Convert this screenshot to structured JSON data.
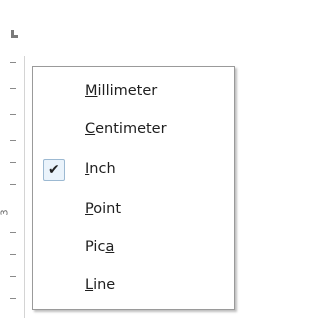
{
  "ruler": {
    "number": "3"
  },
  "menu": {
    "items": [
      {
        "mnemonic": "M",
        "rest": "illimeter",
        "checked": false
      },
      {
        "mnemonic": "C",
        "rest": "entimeter",
        "checked": false
      },
      {
        "mnemonic": "I",
        "rest": "nch",
        "checked": true
      },
      {
        "mnemonic": "P",
        "rest": "oint",
        "checked": false
      },
      {
        "pre": "Pic",
        "mnemonic": "a",
        "checked": false
      },
      {
        "mnemonic": "L",
        "rest": "ine",
        "checked": false
      }
    ],
    "check_symbol": "✔"
  }
}
